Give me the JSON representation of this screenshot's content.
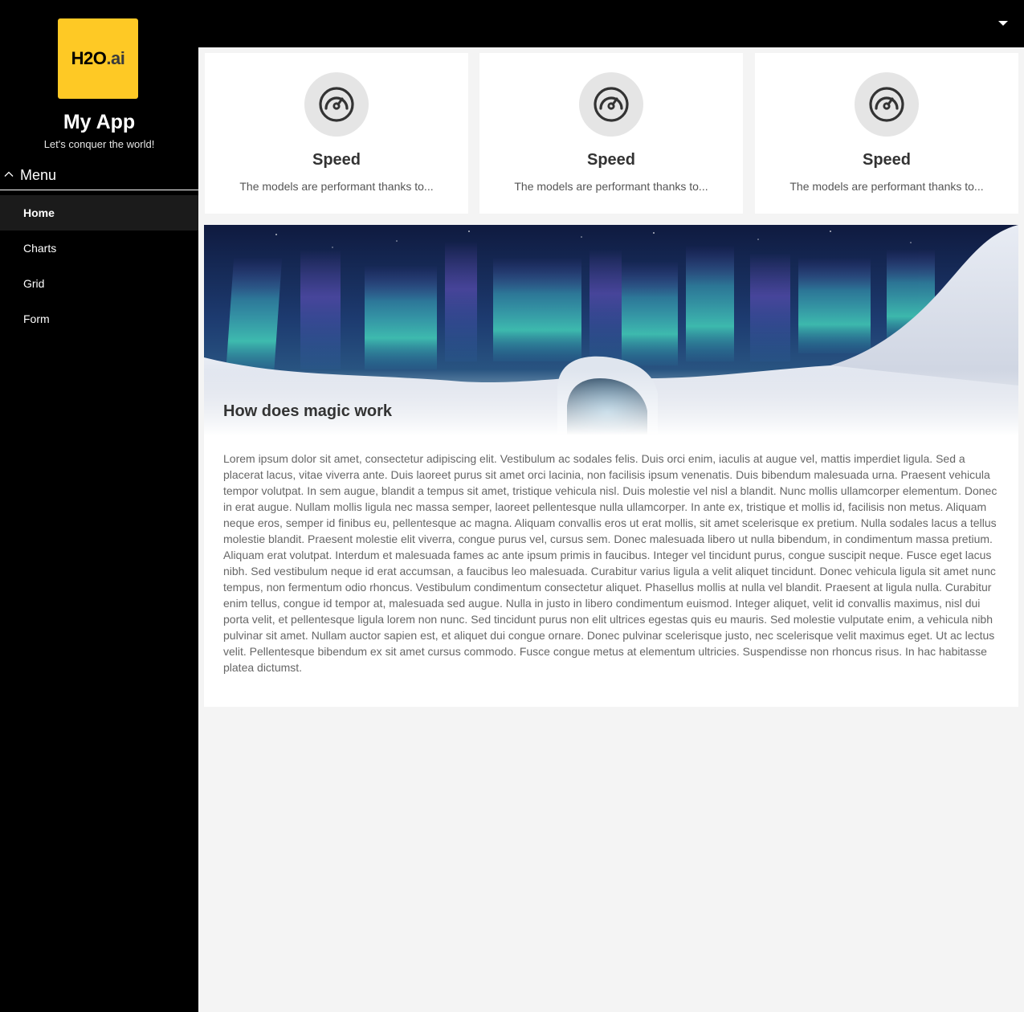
{
  "sidebar": {
    "logo": {
      "main": "H2O",
      "suffix": ".ai"
    },
    "app_title": "My App",
    "app_subtitle": "Let's conquer the world!",
    "menu": {
      "label": "Menu",
      "icon": "chevron-up-icon",
      "items": [
        {
          "label": "Home",
          "active": true
        },
        {
          "label": "Charts",
          "active": false
        },
        {
          "label": "Grid",
          "active": false
        },
        {
          "label": "Form",
          "active": false
        }
      ]
    }
  },
  "header": {
    "dropdown_icon": "caret-down-icon"
  },
  "cards": [
    {
      "icon": "speedometer-icon",
      "title": "Speed",
      "description": "The models are performant thanks to..."
    },
    {
      "icon": "speedometer-icon",
      "title": "Speed",
      "description": "The models are performant thanks to..."
    },
    {
      "icon": "speedometer-icon",
      "title": "Speed",
      "description": "The models are performant thanks to..."
    }
  ],
  "article": {
    "image": "aurora-ice-landscape",
    "title": "How does magic work",
    "body": "Lorem ipsum dolor sit amet, consectetur adipiscing elit. Vestibulum ac sodales felis. Duis orci enim, iaculis at augue vel, mattis imperdiet ligula. Sed a placerat lacus, vitae viverra ante. Duis laoreet purus sit amet orci lacinia, non facilisis ipsum venenatis. Duis bibendum malesuada urna. Praesent vehicula tempor volutpat. In sem augue, blandit a tempus sit amet, tristique vehicula nisl. Duis molestie vel nisl a blandit. Nunc mollis ullamcorper elementum. Donec in erat augue. Nullam mollis ligula nec massa semper, laoreet pellentesque nulla ullamcorper. In ante ex, tristique et mollis id, facilisis non metus. Aliquam neque eros, semper id finibus eu, pellentesque ac magna. Aliquam convallis eros ut erat mollis, sit amet scelerisque ex pretium. Nulla sodales lacus a tellus molestie blandit. Praesent molestie elit viverra, congue purus vel, cursus sem. Donec malesuada libero ut nulla bibendum, in condimentum massa pretium. Aliquam erat volutpat. Interdum et malesuada fames ac ante ipsum primis in faucibus. Integer vel tincidunt purus, congue suscipit neque. Fusce eget lacus nibh. Sed vestibulum neque id erat accumsan, a faucibus leo malesuada. Curabitur varius ligula a velit aliquet tincidunt. Donec vehicula ligula sit amet nunc tempus, non fermentum odio rhoncus. Vestibulum condimentum consectetur aliquet. Phasellus mollis at nulla vel blandit. Praesent at ligula nulla. Curabitur enim tellus, congue id tempor at, malesuada sed augue. Nulla in justo in libero condimentum euismod. Integer aliquet, velit id convallis maximus, nisl dui porta velit, et pellentesque ligula lorem non nunc. Sed tincidunt purus non elit ultrices egestas quis eu mauris. Sed molestie vulputate enim, a vehicula nibh pulvinar sit amet. Nullam auctor sapien est, et aliquet dui congue ornare. Donec pulvinar scelerisque justo, nec scelerisque velit maximus eget. Ut ac lectus velit. Pellentesque bibendum ex sit amet cursus commodo. Fusce congue metus at elementum ultricies. Suspendisse non rhoncus risus. In hac habitasse platea dictumst."
  },
  "colors": {
    "sidebar_bg": "#000000",
    "brand_yellow": "#fec925",
    "page_bg": "#f4f4f4",
    "card_bg": "#ffffff",
    "icon_circle": "#e5e5e5",
    "active_nav_bg": "#1b1b1b"
  }
}
